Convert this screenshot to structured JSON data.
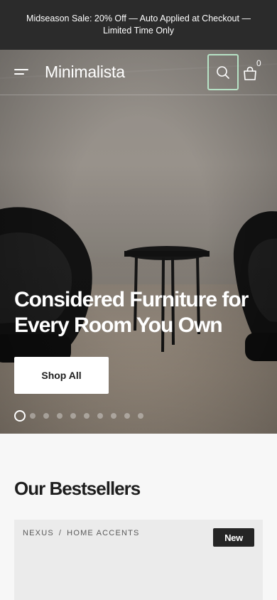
{
  "announcement": "Midseason Sale: 20% Off — Auto Applied at Checkout — Limited Time Only",
  "header": {
    "logo": "Minimalista",
    "cart_count": "0"
  },
  "hero": {
    "title": "Considered Furniture for Every Room You Own",
    "button_label": "Shop All",
    "slides_total": 10,
    "active_slide": 1
  },
  "bestsellers": {
    "title": "Our Bestsellers",
    "card": {
      "vendor": "NEXUS",
      "category": "HOME ACCENTS",
      "badge": "New"
    }
  },
  "colors": {
    "announcement_bg": "#2b2b2b",
    "search_focus": "#b7e3c6",
    "badge_bg": "#252525",
    "page_bg": "#f7f7f7",
    "card_bg": "#ebebeb"
  }
}
